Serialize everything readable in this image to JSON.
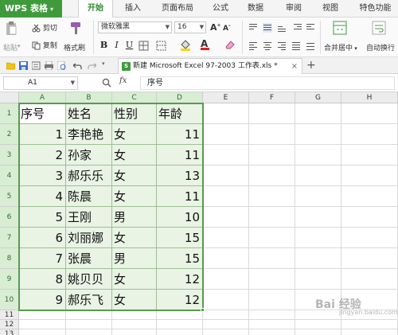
{
  "app": {
    "name": "WPS 表格",
    "caret": "▾"
  },
  "menu": {
    "tabs": [
      "开始",
      "插入",
      "页面布局",
      "公式",
      "数据",
      "审阅",
      "视图",
      "特色功能"
    ],
    "active_index": 0
  },
  "ribbon": {
    "paste": "粘贴",
    "cut": "剪切",
    "copy": "复制",
    "format_painter": "格式刷",
    "font_name": "微软雅黑",
    "font_size": "16",
    "bold": "B",
    "italic": "I",
    "underline": "U",
    "font_color_glyph": "A",
    "merge_center": "合并居中",
    "auto_wrap": "自动换行"
  },
  "document": {
    "tab_label": "新建 Microsoft Excel 97-2003 工作表.xls *",
    "close_glyph": "×",
    "add_glyph": "+",
    "file_badge": "S"
  },
  "formula_bar": {
    "cell_ref": "A1",
    "fx": "fx",
    "value": "序号"
  },
  "columns": [
    "A",
    "B",
    "C",
    "D",
    "E",
    "F",
    "G",
    "H"
  ],
  "rows": [
    "1",
    "2",
    "3",
    "4",
    "5",
    "6",
    "7",
    "8",
    "9",
    "10",
    "11",
    "12",
    "13"
  ],
  "table": {
    "headers": [
      "序号",
      "姓名",
      "性别",
      "年龄"
    ],
    "rows": [
      [
        "1",
        "李艳艳",
        "女",
        "11"
      ],
      [
        "2",
        "孙家",
        "女",
        "11"
      ],
      [
        "3",
        "郝乐乐",
        "女",
        "13"
      ],
      [
        "4",
        "陈晨",
        "女",
        "11"
      ],
      [
        "5",
        "王刚",
        "男",
        "10"
      ],
      [
        "6",
        "刘丽娜",
        "女",
        "15"
      ],
      [
        "7",
        "张晨",
        "男",
        "15"
      ],
      [
        "8",
        "姚贝贝",
        "女",
        "12"
      ],
      [
        "9",
        "郝乐飞",
        "女",
        "12"
      ]
    ]
  },
  "watermark": {
    "text": "Bai 经验",
    "sub": "jingyan.baidu.com"
  },
  "colors": {
    "accent": "#3f9a3c",
    "selection": "#5a9a4e",
    "selected_fill": "#e9f4e5"
  }
}
